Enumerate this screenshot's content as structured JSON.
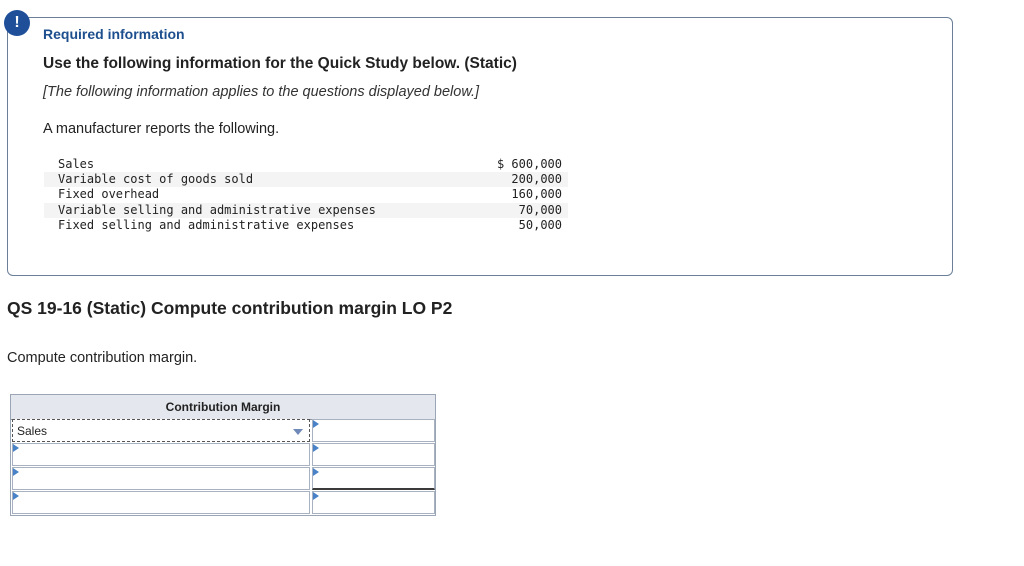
{
  "alert": {
    "symbol": "!"
  },
  "info": {
    "required_label": "Required information",
    "use_title": "Use the following information for the Quick Study below. (Static)",
    "applies_note": "[The following information applies to the questions displayed below.]",
    "intro": "A manufacturer reports the following."
  },
  "data_rows": [
    {
      "label": "Sales",
      "value": "$ 600,000"
    },
    {
      "label": "Variable cost of goods sold",
      "value": "200,000"
    },
    {
      "label": "Fixed overhead",
      "value": "160,000"
    },
    {
      "label": "Variable selling and administrative expenses",
      "value": "70,000"
    },
    {
      "label": "Fixed selling and administrative expenses",
      "value": "50,000"
    }
  ],
  "question": {
    "title": "QS 19-16 (Static) Compute contribution margin LO P2",
    "prompt": "Compute contribution margin."
  },
  "answer_table": {
    "header": "Contribution Margin",
    "rows": [
      {
        "label": "Sales",
        "value": ""
      },
      {
        "label": "",
        "value": ""
      },
      {
        "label": "",
        "value": ""
      },
      {
        "label": "",
        "value": ""
      }
    ]
  },
  "colors": {
    "accent": "#1f4f99",
    "heading_blue": "#1d4f8e",
    "marker": "#4a82c8"
  }
}
